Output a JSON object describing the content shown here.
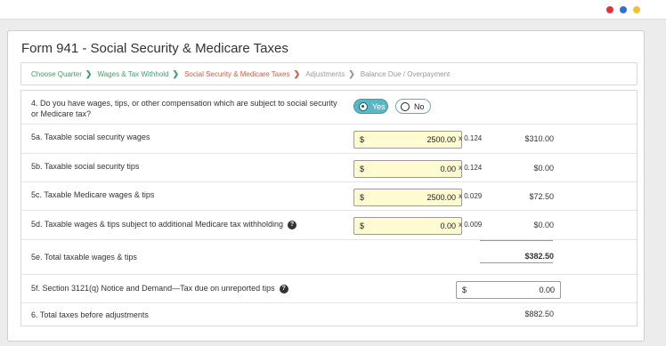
{
  "window": {
    "controls": [
      {
        "name": "red",
        "color": "#e0333c"
      },
      {
        "name": "blue",
        "color": "#2f6fd6"
      },
      {
        "name": "yellow",
        "color": "#f1c22e"
      }
    ]
  },
  "page": {
    "title": "Form 941 - Social Security & Medicare Taxes"
  },
  "steps": [
    {
      "label": "Choose Quarter",
      "state": "done"
    },
    {
      "label": "Wages & Tax Withhold",
      "state": "done"
    },
    {
      "label": "Social Security & Medicare Taxes",
      "state": "active"
    },
    {
      "label": "Adjustments",
      "state": "future"
    },
    {
      "label": "Balance Due / Overpayment",
      "state": "future"
    }
  ],
  "q4": {
    "label": "4. Do you have wages, tips, or other compensation which are subject to social security or Medicare tax?",
    "yes": "Yes",
    "no": "No",
    "selected": "Yes"
  },
  "l5a": {
    "label": "5a. Taxable social security wages",
    "currency": "$",
    "value": "2500.00",
    "rate": "x 0.124",
    "amount": "$310.00"
  },
  "l5b": {
    "label": "5b. Taxable social security tips",
    "currency": "$",
    "value": "0.00",
    "rate": "x 0.124",
    "amount": "$0.00"
  },
  "l5c": {
    "label": "5c. Taxable Medicare wages & tips",
    "currency": "$",
    "value": "2500.00",
    "rate": "x 0.029",
    "amount": "$72.50"
  },
  "l5d": {
    "label": "5d. Taxable wages & tips subject to additional Medicare tax withholding",
    "help": "?",
    "currency": "$",
    "value": "0.00",
    "rate": "x 0.009",
    "amount": "$0.00"
  },
  "l5e": {
    "label": "5e. Total taxable wages & tips",
    "amount": "$382.50"
  },
  "l5f": {
    "label": "5f. Section 3121(q) Notice and Demand—Tax due on unreported tips",
    "help": "?",
    "currency": "$",
    "value": "0.00"
  },
  "l6": {
    "label": "6. Total taxes before adjustments",
    "amount": "$882.50"
  }
}
